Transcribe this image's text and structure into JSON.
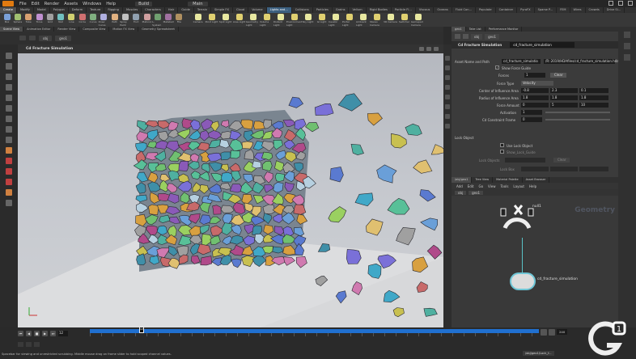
{
  "menubar": {
    "items": [
      "File",
      "Edit",
      "Render",
      "Assets",
      "Windows",
      "Help"
    ],
    "desktop": "Build",
    "context": "Main"
  },
  "shelf_tabs": [
    "Create",
    "Modify",
    "Model",
    "Polygon",
    "Deform",
    "Texture",
    "Rigging",
    "Muscles",
    "Characters",
    "Hair",
    "Guide",
    "Terrain",
    "Simple FX",
    "Cloud",
    "Volume",
    "Lights and...",
    "Collisions",
    "Particles",
    "Grains",
    "Vellum",
    "Rigid Bodies",
    "Particle Fl...",
    "Viscous",
    "Oceans",
    "Fluid Con...",
    "Populate",
    "Container",
    "PyroFX",
    "Sparse P...",
    "FEM",
    "Wires",
    "Crowds",
    "Drive Si..."
  ],
  "shelf_tools": [
    "Box",
    "Sphere",
    "Tube",
    "Torus",
    "Grid",
    "Null",
    "Line",
    "Circle",
    "Curve",
    "Draw Curve",
    "Path",
    "Spray Paint",
    "Font",
    "Platonic",
    "L-System",
    "Metaball",
    "File"
  ],
  "light_tools": [
    "Camera",
    "Point Light",
    "Spot Light",
    "Area Light",
    "Geometry Light",
    "Volume Light",
    "Distant Light",
    "Environment Light",
    "Sky Light",
    "GI Light",
    "Caustic Light",
    "Portal Light",
    "Ambient Light",
    "Stereo Camera",
    "VR Camera",
    "Switcher",
    "Gamepad Camera"
  ],
  "pane_tabs": [
    "Scene View",
    "Animation Editor",
    "Render View",
    "Composite View",
    "Motion FX View",
    "Geometry Spreadsheet"
  ],
  "viewport": {
    "path": "obj",
    "node": "geo1",
    "title": "Cd Fracture Simulation"
  },
  "params": {
    "tabs": [
      "geo1",
      "Take List",
      "Performance Monitor"
    ],
    "path_obj": "obj",
    "path_node": "geo1",
    "title": "Cd Fracture Simulation",
    "node_name": "cd_fracture_simulation",
    "asset_label": "Asset Name and Path",
    "asset_name": "cd_fracture_simulatio",
    "asset_path": "/R::2019/HDAfiles/cd_fracture_simulation.hda",
    "show_force_guide": "Show Force Guide",
    "forces_label": "Forces",
    "forces_value": "1",
    "clear": "Clear",
    "force_type_label": "Force Type",
    "force_type_value": "Velocity",
    "center_label": "Center of Influence Area",
    "center": [
      "-0.8",
      "2.3",
      "0.1"
    ],
    "radius_label": "Radius of Influence Area",
    "radius": [
      "1.8",
      "1.8",
      "1.8"
    ],
    "amount_label": "Force Amount",
    "amount": [
      "0",
      "5",
      "10"
    ],
    "activation_label": "Activation",
    "activation": "1",
    "constraint_label": "Cd Constraint Frame",
    "constraint": "0",
    "lock_section": "Lock Object",
    "use_lock": "Use Lock Object",
    "show_lock": "Show_Lock_Guide",
    "lock_objects": "Lock Objects",
    "lock_clear": "Clear",
    "lock_box": "Lock Box"
  },
  "network": {
    "tabs": [
      "/obj/geo1",
      "Tree View",
      "Material Palette",
      "Asset Browser"
    ],
    "menu": [
      "Add",
      "Edit",
      "Go",
      "View",
      "Tools",
      "Layout",
      "Help"
    ],
    "path_obj": "obj",
    "path_node": "geo1",
    "context_label": "Geometry",
    "null_node": "null1",
    "sim_node": "cd_fracture_simulation"
  },
  "timeline": {
    "frame": "12",
    "cursor": "12",
    "end_frame": "240"
  },
  "status": {
    "message": "Spacebar for viewing and unrestricted scrubbing. Middle mouse drag on frame slider to hold scoped channel values.",
    "path": "/obj/geo1/Lock_f..."
  },
  "colors": {
    "accent": "#e07a10",
    "timeline": "#2070d0",
    "wire": "#59c2c6"
  }
}
